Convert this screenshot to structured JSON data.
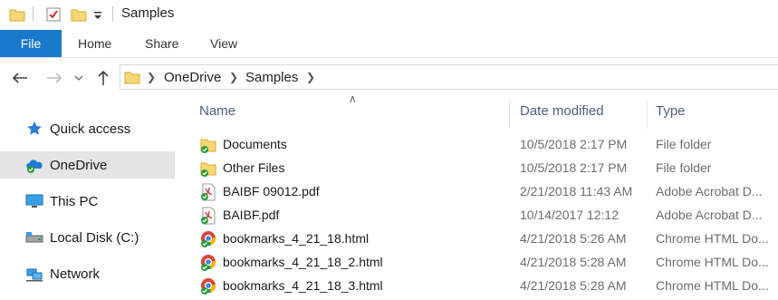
{
  "window": {
    "title": "Samples"
  },
  "quick_access_toolbar": {
    "items": [
      "folder-icon",
      "properties-check-icon",
      "new-folder-icon",
      "customize-dropdown-icon"
    ]
  },
  "ribbon": {
    "file_tab": "File",
    "tabs": [
      "Home",
      "Share",
      "View"
    ]
  },
  "address": {
    "breadcrumbs": [
      "OneDrive",
      "Samples"
    ]
  },
  "nav": {
    "items": [
      {
        "label": "Quick access",
        "icon": "star-icon"
      },
      {
        "label": "OneDrive",
        "icon": "onedrive-cloud-icon",
        "selected": true
      },
      {
        "label": "This PC",
        "icon": "computer-icon"
      },
      {
        "label": "Local Disk (C:)",
        "icon": "drive-icon"
      },
      {
        "label": "Network",
        "icon": "network-icon"
      }
    ]
  },
  "columns": {
    "name": "Name",
    "date": "Date modified",
    "type": "Type"
  },
  "files": [
    {
      "name": "Documents",
      "date": "10/5/2018 2:17 PM",
      "type": "File folder",
      "icon": "folder-synced-icon"
    },
    {
      "name": "Other Files",
      "date": "10/5/2018 2:17 PM",
      "type": "File folder",
      "icon": "folder-synced-icon"
    },
    {
      "name": "BAIBF 09012.pdf",
      "date": "2/21/2018 11:43 AM",
      "type": "Adobe Acrobat D...",
      "icon": "pdf-synced-icon"
    },
    {
      "name": "BAIBF.pdf",
      "date": "10/14/2017 12:12",
      "type": "Adobe Acrobat D...",
      "icon": "pdf-synced-icon"
    },
    {
      "name": "bookmarks_4_21_18.html",
      "date": "4/21/2018 5:26 AM",
      "type": "Chrome HTML Do...",
      "icon": "chrome-synced-icon"
    },
    {
      "name": "bookmarks_4_21_18_2.html",
      "date": "4/21/2018 5:28 AM",
      "type": "Chrome HTML Do...",
      "icon": "chrome-synced-icon"
    },
    {
      "name": "bookmarks_4_21_18_3.html",
      "date": "4/21/2018 5:28 AM",
      "type": "Chrome HTML Do...",
      "icon": "chrome-synced-icon"
    }
  ],
  "colors": {
    "file_tab": "#1979ca",
    "selection": "#e5e5e5",
    "header_text": "#4d6082",
    "secondary_text": "#6d6d6d",
    "sync_green": "#2c9a3a",
    "folder_yellow": "#f7d774"
  }
}
